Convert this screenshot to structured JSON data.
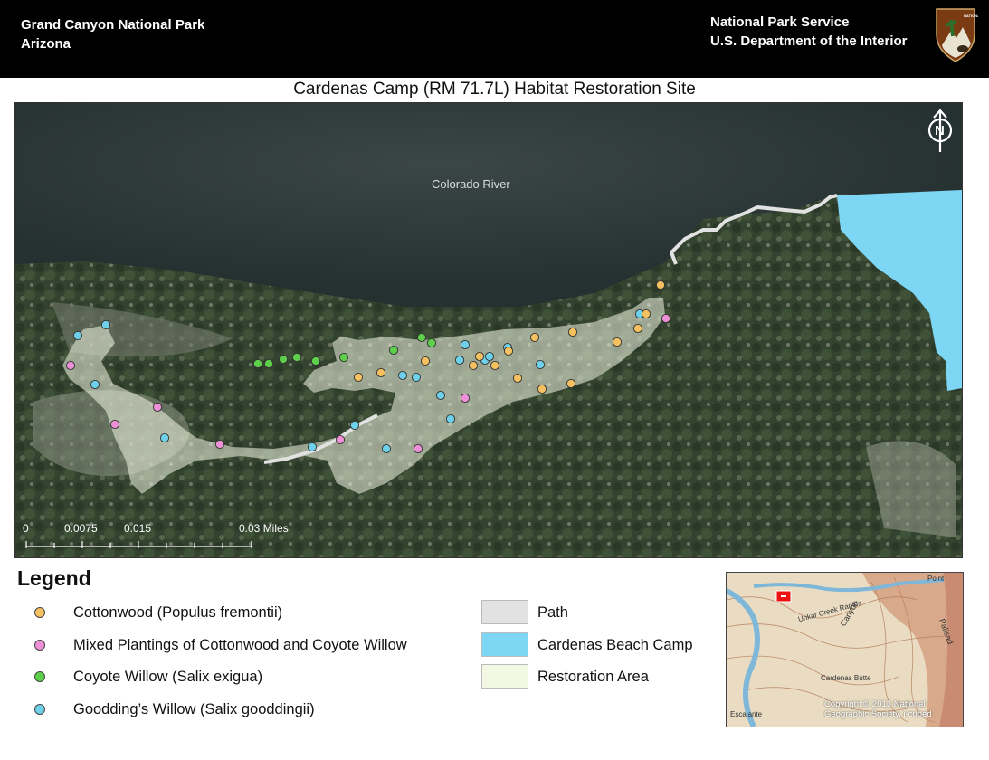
{
  "header": {
    "park_name": "Grand Canyon National Park",
    "state": "Arizona",
    "agency": "National Park Service",
    "department": "U.S. Department of the Interior",
    "logo_icon": "nps-arrowhead-logo"
  },
  "map": {
    "title": "Cardenas Camp (RM 71.7L) Habitat Restoration Site",
    "river_label": "Colorado River",
    "north_arrow_letter": "N",
    "scale_labels": [
      "0",
      "0.0075",
      "0.015",
      "0.03 Miles"
    ],
    "colors": {
      "cottonwood": "#f5c060",
      "mixed": "#ee90d8",
      "coyote": "#5ecf4a",
      "goodding": "#6fd0ea",
      "path": "#e2e2e2",
      "beach": "#7ed6f5",
      "restoration": "#f2f8e4"
    }
  },
  "legend": {
    "title": "Legend",
    "points": [
      {
        "label": "Cottonwood (Populus fremontii)",
        "color": "#f5c060"
      },
      {
        "label": "Mixed Plantings of Cottonwood and Coyote Willow",
        "color": "#ee90d8"
      },
      {
        "label": "Coyote Willow (Salix exigua)",
        "color": "#5ecf4a"
      },
      {
        "label": "Goodding’s Willow (Salix gooddingii)",
        "color": "#6fd0ea"
      }
    ],
    "areas": [
      {
        "label": "Path",
        "color": "#e2e2e2"
      },
      {
        "label": "Cardenas Beach Camp",
        "color": "#7ed6f5"
      },
      {
        "label": "Restoration Area",
        "color": "#f2f8e4"
      }
    ]
  },
  "inset": {
    "labels": [
      "Unkar Creek Rapids",
      "Canyon",
      "Cardenas Butte",
      "Escalante",
      "Palisad",
      "Point"
    ],
    "credit": "Copyright:© 2013 National Geographic Society, i-cubed"
  }
}
